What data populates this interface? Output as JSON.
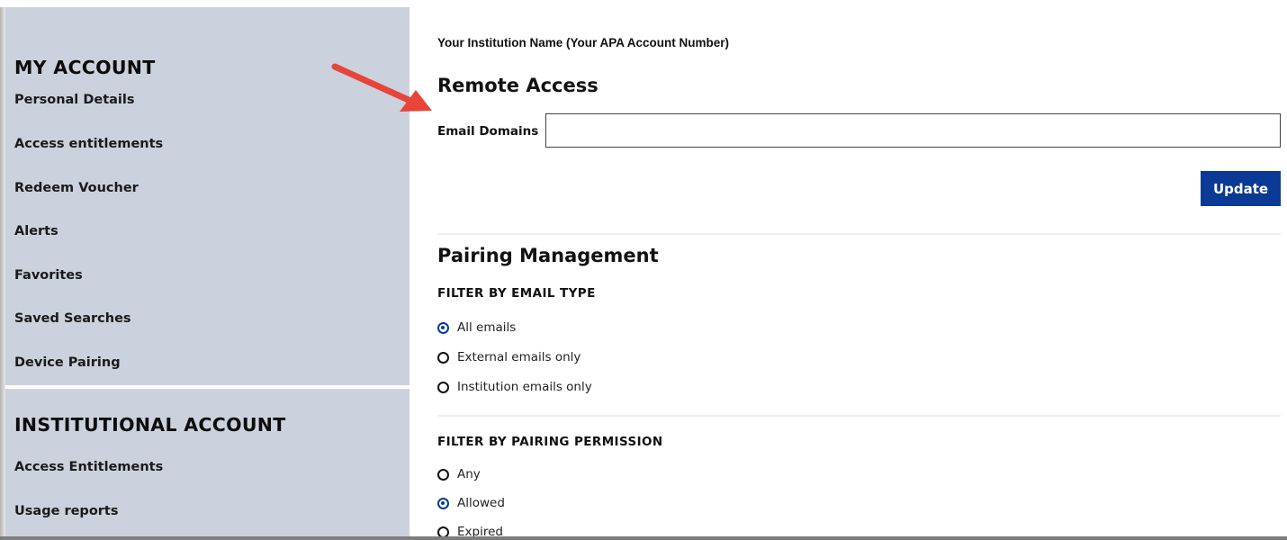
{
  "sidebar": {
    "my_account": {
      "heading": "MY ACCOUNT",
      "items": [
        {
          "label": "Personal Details"
        },
        {
          "label": "Access entitlements"
        },
        {
          "label": "Redeem Voucher"
        },
        {
          "label": "Alerts"
        },
        {
          "label": "Favorites"
        },
        {
          "label": "Saved Searches"
        },
        {
          "label": "Device Pairing"
        }
      ]
    },
    "institutional_account": {
      "heading": "INSTITUTIONAL ACCOUNT",
      "items": [
        {
          "label": "Access Entitlements"
        },
        {
          "label": "Usage reports"
        }
      ]
    }
  },
  "main": {
    "institution_name": "Your Institution Name (Your APA Account Number)",
    "remote_access": {
      "title": "Remote Access",
      "email_domains_label": "Email Domains",
      "email_domains_value": "",
      "update_label": "Update"
    },
    "pairing": {
      "title": "Pairing Management",
      "email_filter": {
        "title": "FILTER BY EMAIL TYPE",
        "options": [
          {
            "label": "All emails",
            "selected": true
          },
          {
            "label": "External emails only",
            "selected": false
          },
          {
            "label": "Institution emails only",
            "selected": false
          }
        ]
      },
      "permission_filter": {
        "title": "FILTER BY PAIRING PERMISSION",
        "options": [
          {
            "label": "Any",
            "selected": false
          },
          {
            "label": "Allowed",
            "selected": true
          },
          {
            "label": "Expired",
            "selected": false
          }
        ]
      }
    }
  },
  "annotation": {
    "icon": "red-arrow-icon",
    "color": "#e8443a"
  },
  "colors": {
    "sidebar_bg": "#cbd1dd",
    "accent": "#0a3a96"
  }
}
